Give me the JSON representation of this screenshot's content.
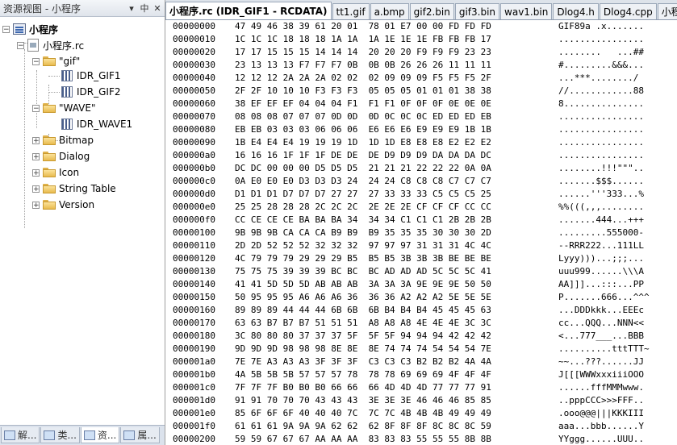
{
  "left_panel": {
    "title": "资源视图 - 小程序",
    "pin_label": "▾ 中 ✕"
  },
  "tree": {
    "root": "小程序",
    "rc": "小程序.rc",
    "gif_folder": "\"gif\"",
    "gif1": "IDR_GIF1",
    "gif2": "IDR_GIF2",
    "wave_folder": "\"WAVE\"",
    "wave1": "IDR_WAVE1",
    "bitmap": "Bitmap",
    "dialog": "Dialog",
    "icon": "Icon",
    "string_table": "String Table",
    "version": "Version"
  },
  "bottom_tabs": [
    "解...",
    "类...",
    "资...",
    "属..."
  ],
  "tabs": [
    "小程序.rc (IDR_GIF1 - RCDATA)",
    "tt1.gif",
    "a.bmp",
    "gif2.bin",
    "gif3.bin",
    "wav1.bin",
    "Dlog4.h",
    "Dlog4.cpp",
    "小程序"
  ],
  "hex_rows": [
    {
      "addr": "00000000",
      "bytes": "47 49 46 38 39 61 20 01  78 01 E7 00 00 FD FD FD",
      "ascii": "GIF89a .x......."
    },
    {
      "addr": "00000010",
      "bytes": "1C 1C 1C 18 18 18 1A 1A  1A 1E 1E 1E FB FB FB 17",
      "ascii": "................"
    },
    {
      "addr": "00000020",
      "bytes": "17 17 15 15 15 14 14 14  20 20 20 F9 F9 F9 23 23",
      "ascii": "........   ...##"
    },
    {
      "addr": "00000030",
      "bytes": "23 13 13 13 F7 F7 F7 0B  0B 0B 26 26 26 11 11 11",
      "ascii": "#.........&&&..."
    },
    {
      "addr": "00000040",
      "bytes": "12 12 12 2A 2A 2A 02 02  02 09 09 09 F5 F5 F5 2F",
      "ascii": "...***......../"
    },
    {
      "addr": "00000050",
      "bytes": "2F 2F 10 10 10 F3 F3 F3  05 05 05 01 01 01 38 38",
      "ascii": "//............88"
    },
    {
      "addr": "00000060",
      "bytes": "38 EF EF EF 04 04 04 F1  F1 F1 0F 0F 0F 0E 0E 0E",
      "ascii": "8..............."
    },
    {
      "addr": "00000070",
      "bytes": "08 08 08 07 07 07 0D 0D  0D 0C 0C 0C ED ED ED EB",
      "ascii": "................"
    },
    {
      "addr": "00000080",
      "bytes": "EB EB 03 03 03 06 06 06  E6 E6 E6 E9 E9 E9 1B 1B",
      "ascii": "................"
    },
    {
      "addr": "00000090",
      "bytes": "1B E4 E4 E4 19 19 19 1D  1D 1D E8 E8 E8 E2 E2 E2",
      "ascii": "................"
    },
    {
      "addr": "000000a0",
      "bytes": "16 16 16 1F 1F 1F DE DE  DE D9 D9 D9 DA DA DA DC",
      "ascii": "................"
    },
    {
      "addr": "000000b0",
      "bytes": "DC DC 00 00 00 D5 D5 D5  21 21 21 22 22 22 0A 0A",
      "ascii": "........!!!\"\"\".."
    },
    {
      "addr": "000000c0",
      "bytes": "0A E0 E0 E0 D3 D3 D3 24  24 24 C8 C8 C8 C7 C7 C7",
      "ascii": ".......$$$......"
    },
    {
      "addr": "000000d0",
      "bytes": "D1 D1 D1 D7 D7 D7 27 27  27 33 33 33 C5 C5 C5 25",
      "ascii": "......'''333...%"
    },
    {
      "addr": "000000e0",
      "bytes": "25 25 28 28 28 2C 2C 2C  2E 2E 2E CF CF CF CC CC",
      "ascii": "%%(((,,,........"
    },
    {
      "addr": "000000f0",
      "bytes": "CC CE CE CE BA BA BA 34  34 34 C1 C1 C1 2B 2B 2B",
      "ascii": ".......444...+++"
    },
    {
      "addr": "00000100",
      "bytes": "9B 9B 9B CA CA CA B9 B9  B9 35 35 35 30 30 30 2D",
      "ascii": ".........555000-"
    },
    {
      "addr": "00000110",
      "bytes": "2D 2D 52 52 52 32 32 32  97 97 97 31 31 31 4C 4C",
      "ascii": "--RRR222...111LL"
    },
    {
      "addr": "00000120",
      "bytes": "4C 79 79 79 29 29 29 B5  B5 B5 3B 3B 3B BE BE BE",
      "ascii": "Lyyy)))...;;;..."
    },
    {
      "addr": "00000130",
      "bytes": "75 75 75 39 39 39 BC BC  BC AD AD AD 5C 5C 5C 41",
      "ascii": "uuu999......\\\\\\A"
    },
    {
      "addr": "00000140",
      "bytes": "41 41 5D 5D 5D AB AB AB  3A 3A 3A 9E 9E 9E 50 50",
      "ascii": "AA]]]...:::...PP"
    },
    {
      "addr": "00000150",
      "bytes": "50 95 95 95 A6 A6 A6 36  36 36 A2 A2 A2 5E 5E 5E",
      "ascii": "P.......666...^^^"
    },
    {
      "addr": "00000160",
      "bytes": "89 89 89 44 44 44 6B 6B  6B B4 B4 B4 45 45 45 63",
      "ascii": "...DDDkkk...EEEc"
    },
    {
      "addr": "00000170",
      "bytes": "63 63 B7 B7 B7 51 51 51  A8 A8 A8 4E 4E 4E 3C 3C",
      "ascii": "cc...QQQ...NNN<<"
    },
    {
      "addr": "00000180",
      "bytes": "3C 80 80 80 37 37 37 5F  5F 5F 94 94 94 42 42 42",
      "ascii": "<...777___...BBB"
    },
    {
      "addr": "00000190",
      "bytes": "9D 9D 9D 98 98 98 8E 8E  8E 74 74 74 54 54 54 7E",
      "ascii": "..........tttTTT~"
    },
    {
      "addr": "000001a0",
      "bytes": "7E 7E A3 A3 A3 3F 3F 3F  C3 C3 C3 B2 B2 B2 4A 4A",
      "ascii": "~~...???......JJ"
    },
    {
      "addr": "000001b0",
      "bytes": "4A 5B 5B 5B 57 57 57 78  78 78 69 69 69 4F 4F 4F",
      "ascii": "J[[[WWWxxxiiiOOO"
    },
    {
      "addr": "000001c0",
      "bytes": "7F 7F 7F B0 B0 B0 66 66  66 4D 4D 4D 77 77 77 91",
      "ascii": "......fffMMMwww."
    },
    {
      "addr": "000001d0",
      "bytes": "91 91 70 70 70 43 43 43  3E 3E 3E 46 46 46 85 85",
      "ascii": "..pppCCC>>>FFF.."
    },
    {
      "addr": "000001e0",
      "bytes": "85 6F 6F 6F 40 40 40 7C  7C 7C 4B 4B 4B 49 49 49",
      "ascii": ".ooo@@@|||KKKIII"
    },
    {
      "addr": "000001f0",
      "bytes": "61 61 61 9A 9A 9A 62 62  62 8F 8F 8F 8C 8C 8C 59",
      "ascii": "aaa...bbb......Y"
    },
    {
      "addr": "00000200",
      "bytes": "59 59 67 67 67 AA AA AA  83 83 83 55 55 55 8B 8B",
      "ascii": "YYggg......UUU.."
    }
  ]
}
